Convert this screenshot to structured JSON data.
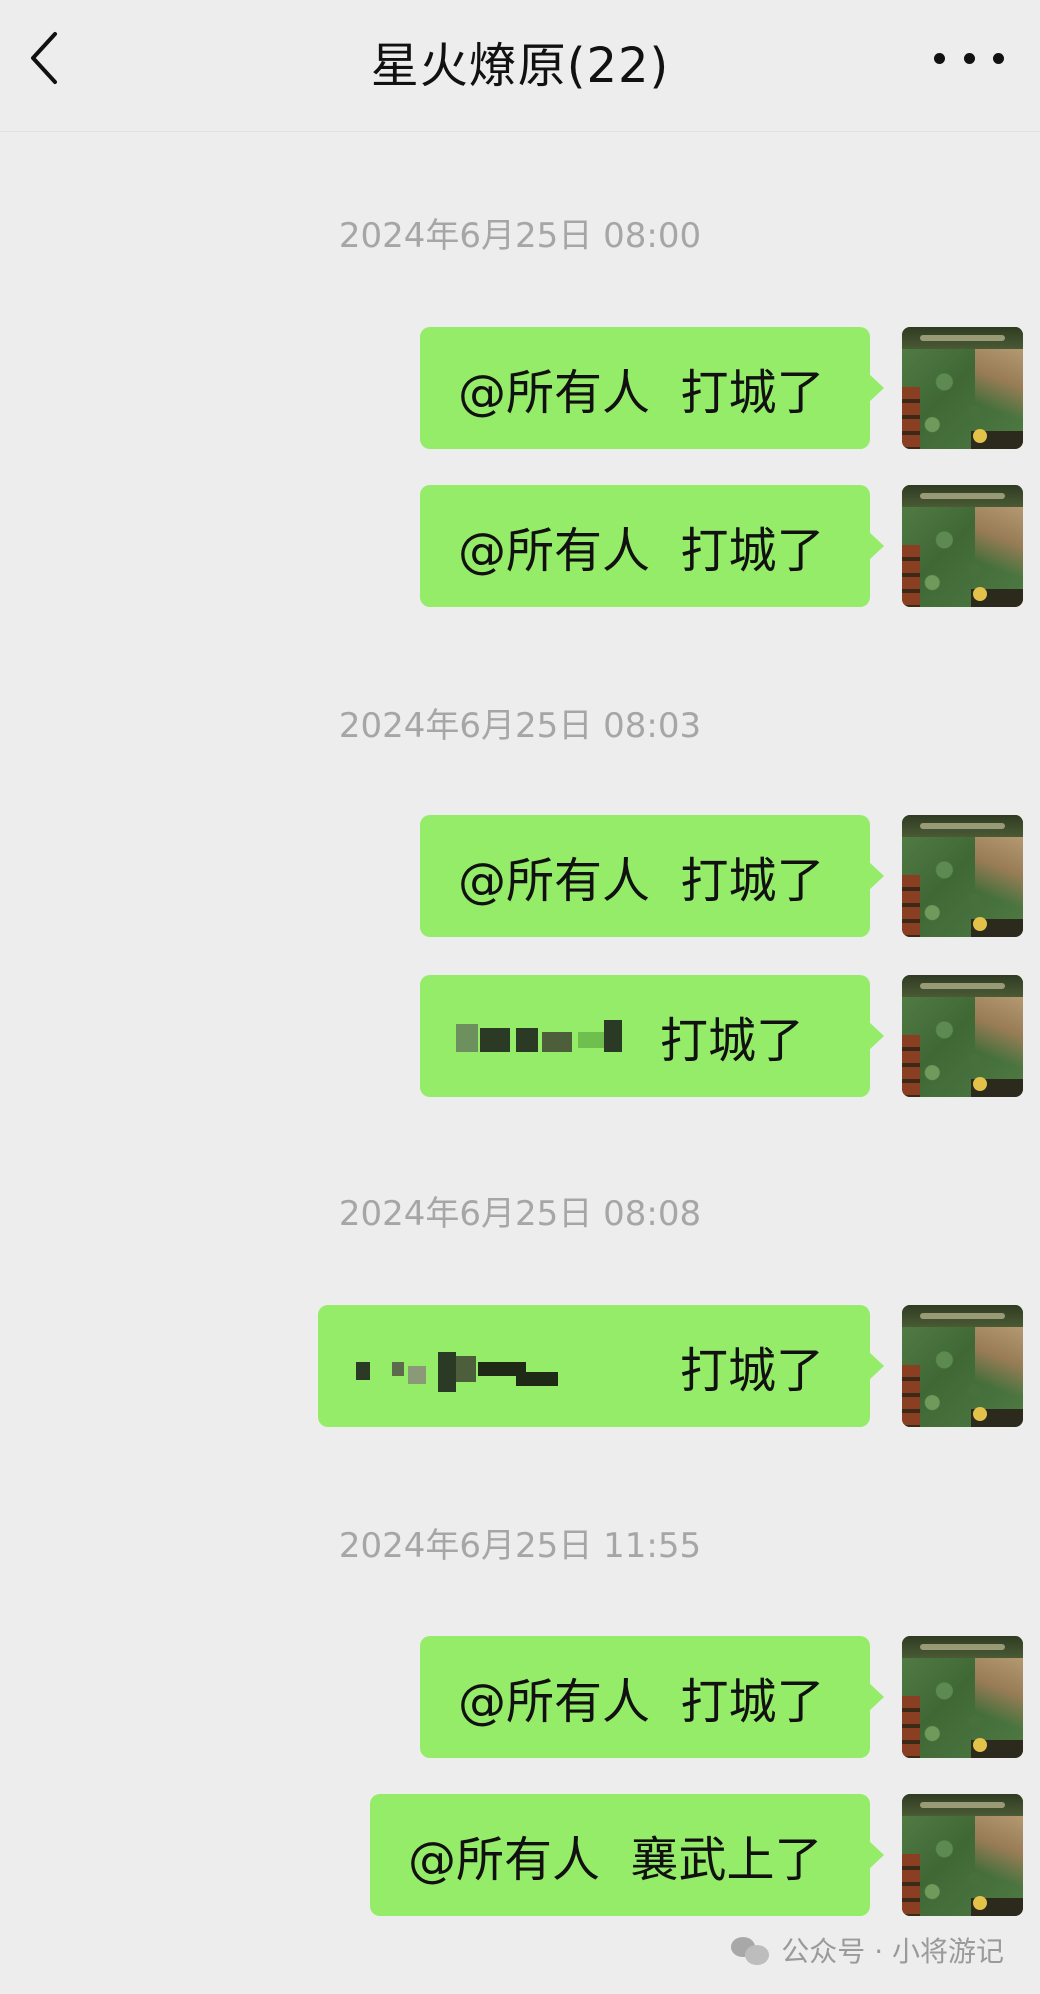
{
  "header": {
    "title": "星火燎原(22)"
  },
  "timestamps": [
    "2024年6月25日 08:00",
    "2024年6月25日 08:03",
    "2024年6月25日 08:08",
    "2024年6月25日 11:55"
  ],
  "messages": [
    {
      "text": "@所有人  打城了"
    },
    {
      "text": "@所有人  打城了"
    },
    {
      "text": "@所有人  打城了"
    },
    {
      "text": "打城了"
    },
    {
      "text": "打城了"
    },
    {
      "text": "@所有人  打城了"
    },
    {
      "text": "@所有人  襄武上了"
    }
  ],
  "watermark": {
    "text": "公众号 · 小将游记"
  },
  "colors": {
    "background": "#ededed",
    "bubble": "#95ec69",
    "timestamp_text": "#a6a6a6"
  },
  "icons": {
    "back": "chevron-left-icon",
    "more": "more-dots-icon",
    "watermark": "wechat-icon"
  }
}
